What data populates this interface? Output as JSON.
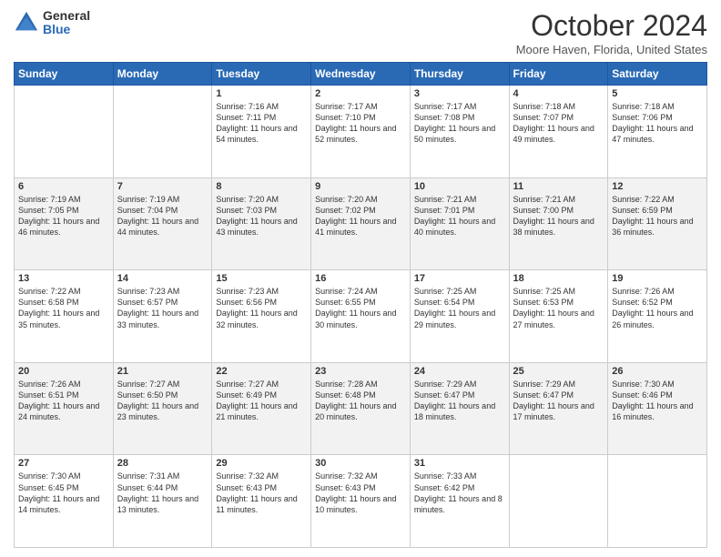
{
  "logo": {
    "general": "General",
    "blue": "Blue"
  },
  "header": {
    "month": "October 2024",
    "location": "Moore Haven, Florida, United States"
  },
  "days_of_week": [
    "Sunday",
    "Monday",
    "Tuesday",
    "Wednesday",
    "Thursday",
    "Friday",
    "Saturday"
  ],
  "weeks": [
    [
      {
        "day": "",
        "info": ""
      },
      {
        "day": "",
        "info": ""
      },
      {
        "day": "1",
        "info": "Sunrise: 7:16 AM\nSunset: 7:11 PM\nDaylight: 11 hours and 54 minutes."
      },
      {
        "day": "2",
        "info": "Sunrise: 7:17 AM\nSunset: 7:10 PM\nDaylight: 11 hours and 52 minutes."
      },
      {
        "day": "3",
        "info": "Sunrise: 7:17 AM\nSunset: 7:08 PM\nDaylight: 11 hours and 50 minutes."
      },
      {
        "day": "4",
        "info": "Sunrise: 7:18 AM\nSunset: 7:07 PM\nDaylight: 11 hours and 49 minutes."
      },
      {
        "day": "5",
        "info": "Sunrise: 7:18 AM\nSunset: 7:06 PM\nDaylight: 11 hours and 47 minutes."
      }
    ],
    [
      {
        "day": "6",
        "info": "Sunrise: 7:19 AM\nSunset: 7:05 PM\nDaylight: 11 hours and 46 minutes."
      },
      {
        "day": "7",
        "info": "Sunrise: 7:19 AM\nSunset: 7:04 PM\nDaylight: 11 hours and 44 minutes."
      },
      {
        "day": "8",
        "info": "Sunrise: 7:20 AM\nSunset: 7:03 PM\nDaylight: 11 hours and 43 minutes."
      },
      {
        "day": "9",
        "info": "Sunrise: 7:20 AM\nSunset: 7:02 PM\nDaylight: 11 hours and 41 minutes."
      },
      {
        "day": "10",
        "info": "Sunrise: 7:21 AM\nSunset: 7:01 PM\nDaylight: 11 hours and 40 minutes."
      },
      {
        "day": "11",
        "info": "Sunrise: 7:21 AM\nSunset: 7:00 PM\nDaylight: 11 hours and 38 minutes."
      },
      {
        "day": "12",
        "info": "Sunrise: 7:22 AM\nSunset: 6:59 PM\nDaylight: 11 hours and 36 minutes."
      }
    ],
    [
      {
        "day": "13",
        "info": "Sunrise: 7:22 AM\nSunset: 6:58 PM\nDaylight: 11 hours and 35 minutes."
      },
      {
        "day": "14",
        "info": "Sunrise: 7:23 AM\nSunset: 6:57 PM\nDaylight: 11 hours and 33 minutes."
      },
      {
        "day": "15",
        "info": "Sunrise: 7:23 AM\nSunset: 6:56 PM\nDaylight: 11 hours and 32 minutes."
      },
      {
        "day": "16",
        "info": "Sunrise: 7:24 AM\nSunset: 6:55 PM\nDaylight: 11 hours and 30 minutes."
      },
      {
        "day": "17",
        "info": "Sunrise: 7:25 AM\nSunset: 6:54 PM\nDaylight: 11 hours and 29 minutes."
      },
      {
        "day": "18",
        "info": "Sunrise: 7:25 AM\nSunset: 6:53 PM\nDaylight: 11 hours and 27 minutes."
      },
      {
        "day": "19",
        "info": "Sunrise: 7:26 AM\nSunset: 6:52 PM\nDaylight: 11 hours and 26 minutes."
      }
    ],
    [
      {
        "day": "20",
        "info": "Sunrise: 7:26 AM\nSunset: 6:51 PM\nDaylight: 11 hours and 24 minutes."
      },
      {
        "day": "21",
        "info": "Sunrise: 7:27 AM\nSunset: 6:50 PM\nDaylight: 11 hours and 23 minutes."
      },
      {
        "day": "22",
        "info": "Sunrise: 7:27 AM\nSunset: 6:49 PM\nDaylight: 11 hours and 21 minutes."
      },
      {
        "day": "23",
        "info": "Sunrise: 7:28 AM\nSunset: 6:48 PM\nDaylight: 11 hours and 20 minutes."
      },
      {
        "day": "24",
        "info": "Sunrise: 7:29 AM\nSunset: 6:47 PM\nDaylight: 11 hours and 18 minutes."
      },
      {
        "day": "25",
        "info": "Sunrise: 7:29 AM\nSunset: 6:47 PM\nDaylight: 11 hours and 17 minutes."
      },
      {
        "day": "26",
        "info": "Sunrise: 7:30 AM\nSunset: 6:46 PM\nDaylight: 11 hours and 16 minutes."
      }
    ],
    [
      {
        "day": "27",
        "info": "Sunrise: 7:30 AM\nSunset: 6:45 PM\nDaylight: 11 hours and 14 minutes."
      },
      {
        "day": "28",
        "info": "Sunrise: 7:31 AM\nSunset: 6:44 PM\nDaylight: 11 hours and 13 minutes."
      },
      {
        "day": "29",
        "info": "Sunrise: 7:32 AM\nSunset: 6:43 PM\nDaylight: 11 hours and 11 minutes."
      },
      {
        "day": "30",
        "info": "Sunrise: 7:32 AM\nSunset: 6:43 PM\nDaylight: 11 hours and 10 minutes."
      },
      {
        "day": "31",
        "info": "Sunrise: 7:33 AM\nSunset: 6:42 PM\nDaylight: 11 hours and 8 minutes."
      },
      {
        "day": "",
        "info": ""
      },
      {
        "day": "",
        "info": ""
      }
    ]
  ]
}
